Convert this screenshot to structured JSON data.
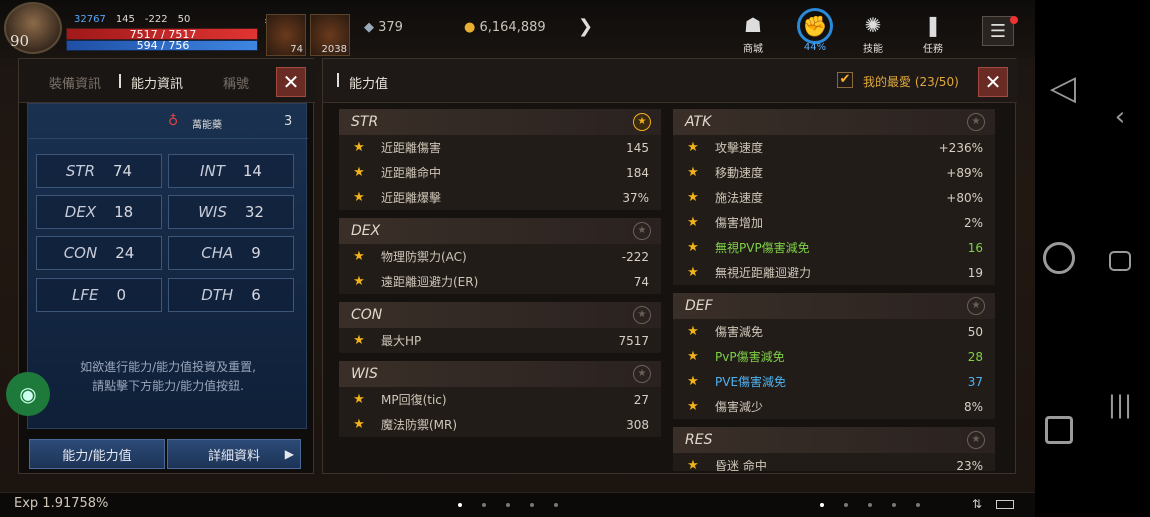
{
  "hud": {
    "level": "90",
    "stat_a": "32767",
    "stat_b": "145",
    "stat_c": "-222",
    "stat_d": "50",
    "hp": "7517 / 7517",
    "mp": "594 / 756",
    "potion_count": "74",
    "quick_count": "2038",
    "currency_a": "379",
    "gold": "6,164,889",
    "buttons": [
      {
        "label": "商城",
        "icon": "shop-bag-icon"
      },
      {
        "label": "44%",
        "icon": "auto-fist-icon"
      },
      {
        "label": "技能",
        "icon": "skill-icon"
      },
      {
        "label": "任務",
        "icon": "quest-scroll-icon"
      }
    ]
  },
  "left": {
    "tabs": [
      "裝備資訊",
      "能力資訊",
      "稱號"
    ],
    "elixir_label": "萬能藥",
    "elixir_count": "3",
    "stats": [
      {
        "k": "STR",
        "v": "74"
      },
      {
        "k": "INT",
        "v": "14"
      },
      {
        "k": "DEX",
        "v": "18"
      },
      {
        "k": "WIS",
        "v": "32"
      },
      {
        "k": "CON",
        "v": "24"
      },
      {
        "k": "CHA",
        "v": "9"
      },
      {
        "k": "LFE",
        "v": "0"
      },
      {
        "k": "DTH",
        "v": "6"
      }
    ],
    "hint_line1": "如欲進行能力/能力值投資及重置,",
    "hint_line2": "請點擊下方能力/能力值按鈕.",
    "btn_ability": "能力/能力值",
    "btn_detail": "詳細資料"
  },
  "right": {
    "title": "能力值",
    "favorite": "我的最愛 (23/50)",
    "left_sections": [
      {
        "name": "STR",
        "fav": true,
        "rows": [
          {
            "n": "近距離傷害",
            "v": "145"
          },
          {
            "n": "近距離命中",
            "v": "184"
          },
          {
            "n": "近距離爆擊",
            "v": "37%"
          }
        ]
      },
      {
        "name": "DEX",
        "fav": false,
        "rows": [
          {
            "n": "物理防禦力(AC)",
            "v": "-222"
          },
          {
            "n": "遠距離迴避力(ER)",
            "v": "74"
          }
        ]
      },
      {
        "name": "CON",
        "fav": false,
        "rows": [
          {
            "n": "最大HP",
            "v": "7517"
          }
        ]
      },
      {
        "name": "WIS",
        "fav": false,
        "rows": [
          {
            "n": "MP回復(tic)",
            "v": "27"
          },
          {
            "n": "魔法防禦(MR)",
            "v": "308"
          }
        ]
      }
    ],
    "right_sections": [
      {
        "name": "ATK",
        "fav": false,
        "rows": [
          {
            "n": "攻擊速度",
            "v": "+236%"
          },
          {
            "n": "移動速度",
            "v": "+89%"
          },
          {
            "n": "施法速度",
            "v": "+80%"
          },
          {
            "n": "傷害增加",
            "v": "2%"
          },
          {
            "n": "無視PVP傷害減免",
            "v": "16",
            "c": "green"
          },
          {
            "n": "無視近距離迴避力",
            "v": "19"
          }
        ]
      },
      {
        "name": "DEF",
        "fav": false,
        "rows": [
          {
            "n": "傷害減免",
            "v": "50"
          },
          {
            "n": "PvP傷害減免",
            "v": "28",
            "c": "green"
          },
          {
            "n": "PVE傷害減免",
            "v": "37",
            "c": "blue"
          },
          {
            "n": "傷害減少",
            "v": "8%"
          }
        ]
      },
      {
        "name": "RES",
        "fav": false,
        "rows": [
          {
            "n": "昏迷 命中",
            "v": "23%"
          }
        ]
      }
    ]
  },
  "bottom": {
    "exp": "Exp 1.91758%"
  },
  "colors": {
    "accent": "#f2b31a",
    "green": "#7ed046",
    "blue": "#4fb2f0",
    "close": "#6b2b25"
  }
}
